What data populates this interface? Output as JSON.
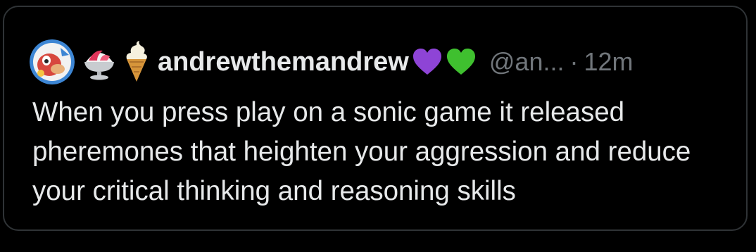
{
  "post": {
    "author": {
      "display_name": "andrewthemandrew",
      "emojis_before_name": [
        "avatar-emblem-icon",
        "shaved-ice-icon",
        "soft-serve-icon"
      ],
      "hearts_after_name": [
        "purple-heart-icon",
        "green-heart-icon"
      ],
      "handle": "@an...",
      "separator": "·"
    },
    "timestamp": "12m",
    "text": "When you press play on a sonic game it released pheremones that heighten your aggression and reduce your critical thinking and reasoning skills"
  },
  "colors": {
    "background": "#000000",
    "border": "#2f3336",
    "primary_text": "#e7e9ea",
    "secondary_text": "#71767b",
    "purple_heart": "#8e44d6",
    "green_heart": "#3fc02f"
  }
}
